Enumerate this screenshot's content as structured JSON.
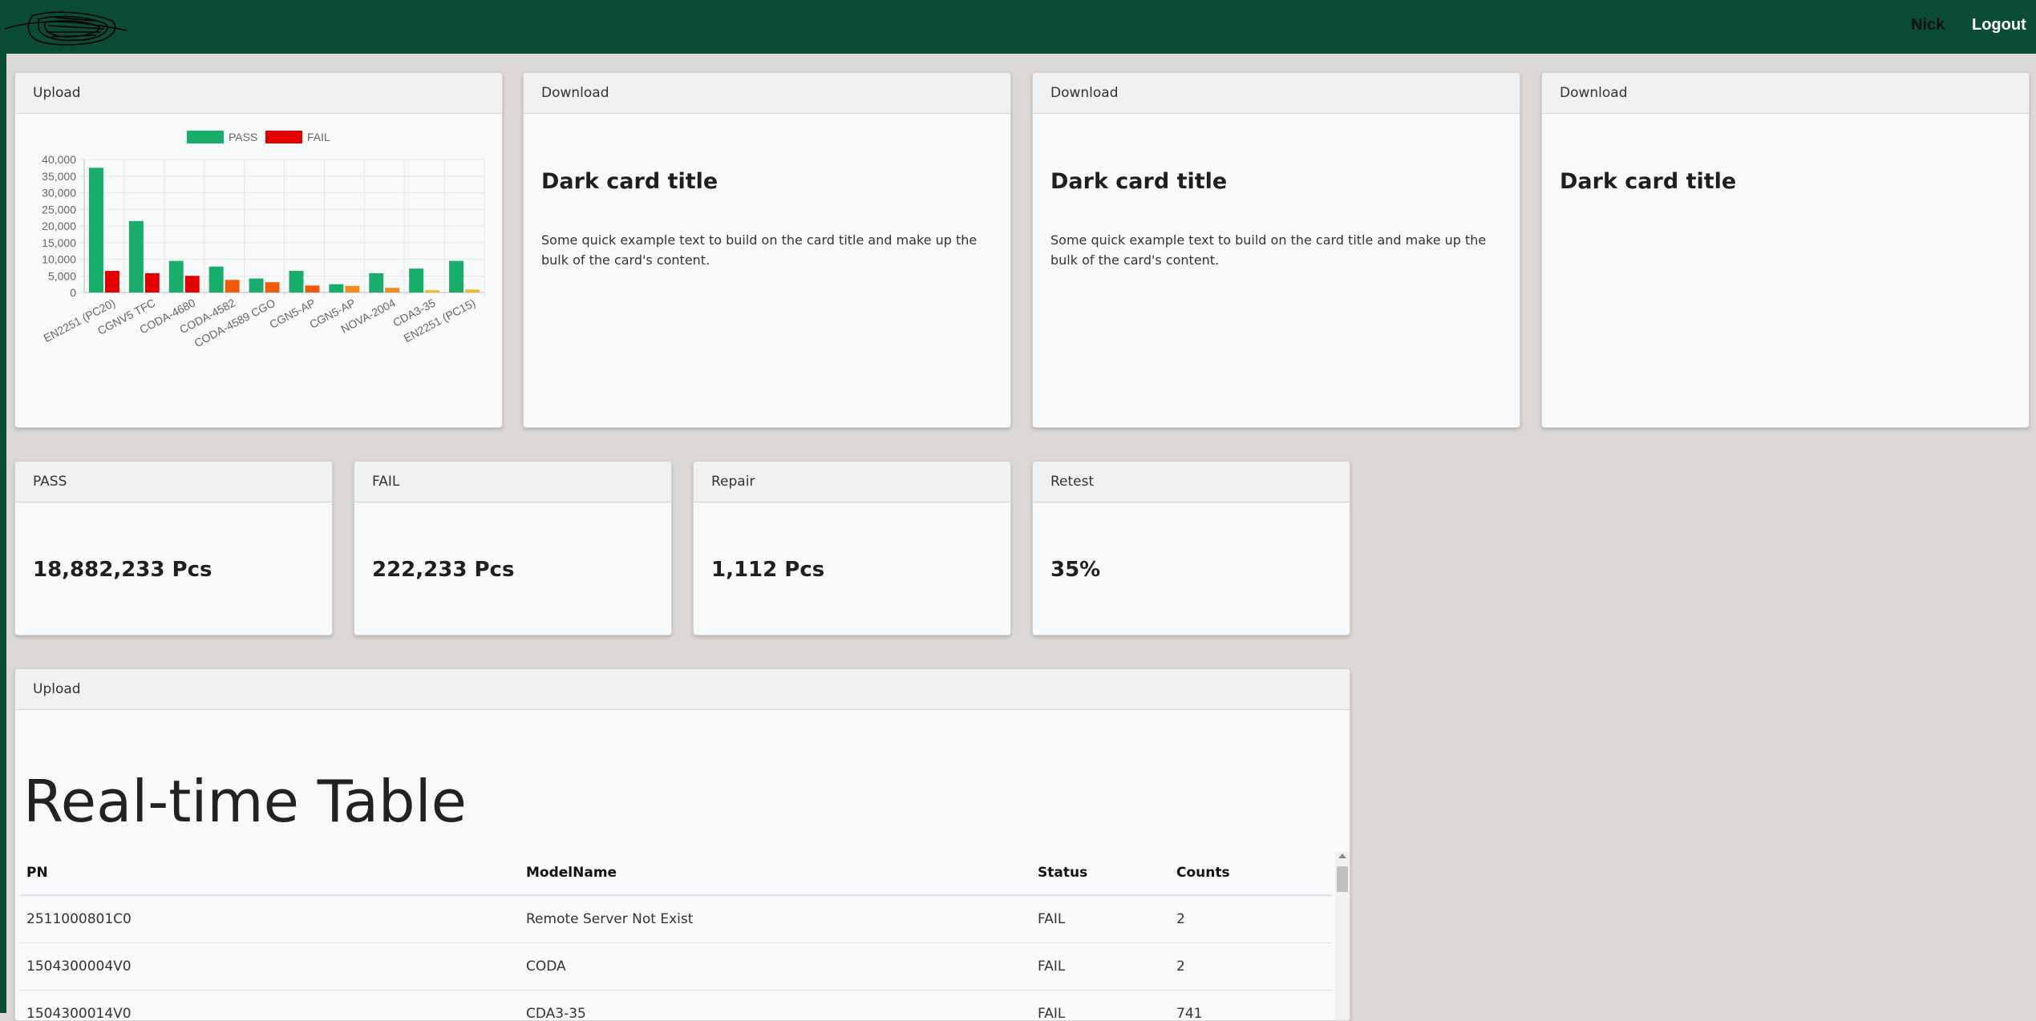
{
  "navbar": {
    "user": "Nick",
    "logout": "Logout"
  },
  "top_cards": [
    {
      "header": "Upload"
    },
    {
      "header": "Download",
      "title": "Dark card title",
      "text": "Some quick example text to build on the card title and make up the bulk of the card's content."
    },
    {
      "header": "Download",
      "title": "Dark card title",
      "text": "Some quick example text to build on the card title and make up the bulk of the card's content."
    },
    {
      "header": "Download",
      "title": "Dark card title"
    }
  ],
  "stats": [
    {
      "header": "PASS",
      "value": "18,882,233 Pcs"
    },
    {
      "header": "FAIL",
      "value": "222,233 Pcs"
    },
    {
      "header": "Repair",
      "value": "1,112 Pcs"
    },
    {
      "header": "Retest",
      "value": "35%"
    }
  ],
  "table_card": {
    "header": "Upload",
    "title": "Real-time Table",
    "columns": [
      "PN",
      "ModelName",
      "Status",
      "Counts"
    ],
    "rows": [
      [
        "2511000801C0",
        "Remote Server Not Exist",
        "FAIL",
        "2"
      ],
      [
        "1504300004V0",
        "CODA",
        "FAIL",
        "2"
      ],
      [
        "1504300014V0",
        "CDA3-35",
        "FAIL",
        "741"
      ]
    ]
  },
  "chart_data": {
    "type": "bar",
    "categories": [
      "EN2251 (PC20)",
      "CGNV5 TFC",
      "CODA-4680",
      "CODA-4582",
      "CODA-4589 CGO",
      "CGN5-AP",
      "CGN5-AP",
      "NOVA-2004",
      "CDA3-35",
      "EN2251 (PC15)"
    ],
    "series": [
      {
        "name": "PASS",
        "values": [
          37500,
          21500,
          9500,
          7800,
          4200,
          6500,
          2500,
          5800,
          7200,
          9500
        ]
      },
      {
        "name": "FAIL",
        "values": [
          6500,
          5800,
          5000,
          3800,
          3100,
          2100,
          2000,
          1400,
          700,
          900
        ]
      }
    ],
    "fail_bar_colors": [
      "#e30000",
      "#e30000",
      "#e30000",
      "#f05a0a",
      "#f05a0a",
      "#f05a0a",
      "#f28c1e",
      "#f28c1e",
      "#f5b731",
      "#f5b731"
    ],
    "yticks": [
      "40,000",
      "35,000",
      "30,000",
      "25,000",
      "20,000",
      "15,000",
      "10,000",
      "5,000",
      "0"
    ],
    "ylim": [
      0,
      40000
    ],
    "colors": {
      "PASS": "#18ad6b",
      "FAIL": "#e30000"
    },
    "legend": "top",
    "grid": true
  }
}
